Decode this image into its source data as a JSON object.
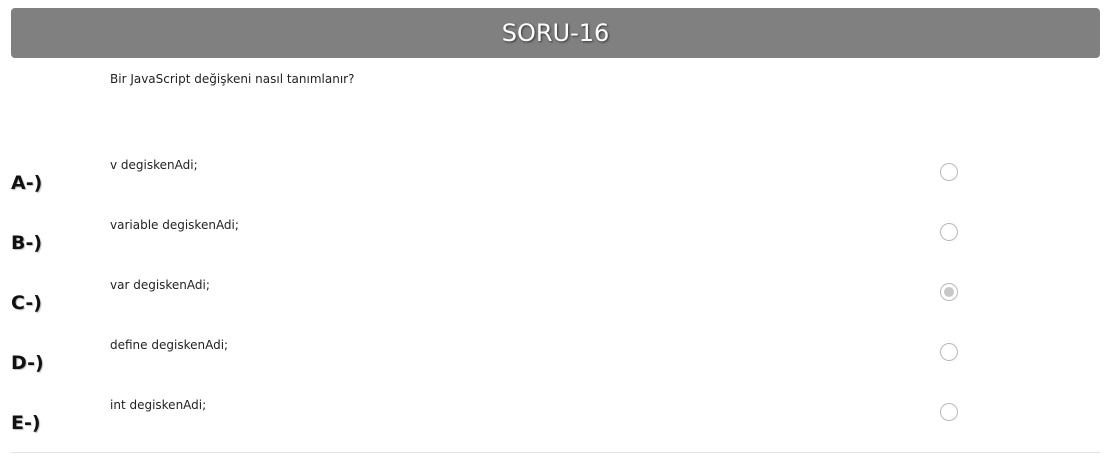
{
  "header": {
    "title": "SORU-16"
  },
  "question": {
    "text": "Bir JavaScript değişkeni nasıl tanımlanır?"
  },
  "options": [
    {
      "letter": "A-)",
      "text": "v degiskenAdi;",
      "selected": false
    },
    {
      "letter": "B-)",
      "text": "variable degiskenAdi;",
      "selected": false
    },
    {
      "letter": "C-)",
      "text": "var degiskenAdi;",
      "selected": true
    },
    {
      "letter": "D-)",
      "text": "define degiskenAdi;",
      "selected": false
    },
    {
      "letter": "E-)",
      "text": "int degiskenAdi;",
      "selected": false
    }
  ],
  "colors": {
    "header_bg": "#808080",
    "header_text": "#ffffff",
    "radio_border": "#b9b9b9",
    "radio_checked": "#c7c7c7"
  }
}
